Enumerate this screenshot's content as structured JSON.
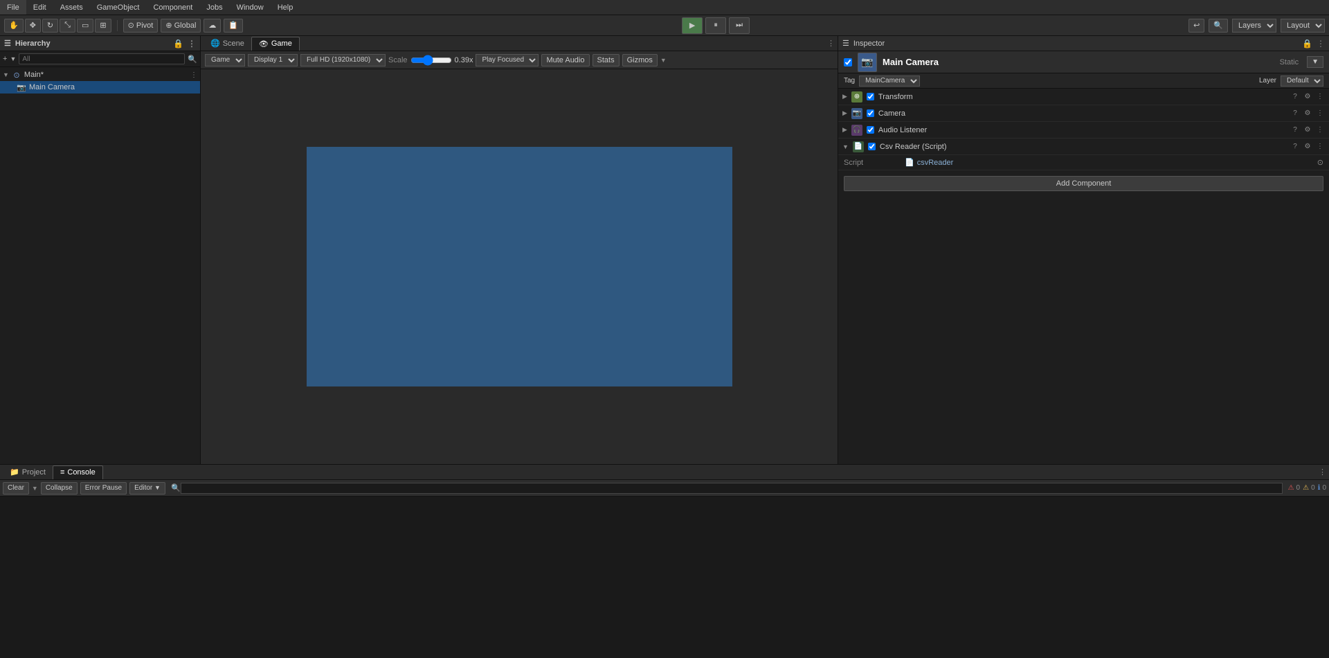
{
  "menubar": {
    "items": [
      "File",
      "Edit",
      "Assets",
      "GameObject",
      "Component",
      "Jobs",
      "Window",
      "Help"
    ]
  },
  "toolbar": {
    "layers_label": "Layers",
    "layout_label": "Layout"
  },
  "hierarchy": {
    "panel_title": "Hierarchy",
    "search_placeholder": "All",
    "items": [
      {
        "label": "Main*",
        "type": "scene",
        "indent": 0
      },
      {
        "label": "Main Camera",
        "type": "camera",
        "indent": 1
      }
    ]
  },
  "game_view": {
    "tabs": [
      {
        "label": "Scene",
        "active": false
      },
      {
        "label": "Game",
        "active": true
      }
    ],
    "toolbar": {
      "display": "Game",
      "display1": "Display 1",
      "resolution": "Full HD (1920x1080)",
      "scale_label": "Scale",
      "scale_value": "0.39x",
      "play_focused": "Play Focused",
      "mute_audio": "Mute Audio",
      "stats": "Stats",
      "gizmos": "Gizmos"
    },
    "canvas_color": "#2f5880"
  },
  "inspector": {
    "panel_title": "Inspector",
    "object_name": "Main Camera",
    "static_label": "Static",
    "tag_label": "Tag",
    "tag_value": "MainCamera",
    "layer_label": "Layer",
    "layer_value": "Default",
    "components": [
      {
        "name": "Transform",
        "type": "transform",
        "enabled": true
      },
      {
        "name": "Camera",
        "type": "camera",
        "enabled": true
      },
      {
        "name": "Audio Listener",
        "type": "audio",
        "enabled": true
      },
      {
        "name": "Csv Reader (Script)",
        "type": "script",
        "enabled": true
      }
    ],
    "script_label": "Script",
    "script_value": "csvReader",
    "add_component_label": "Add Component"
  },
  "bottom": {
    "tabs": [
      {
        "label": "Project",
        "active": false
      },
      {
        "label": "Console",
        "active": true
      }
    ],
    "console": {
      "clear_label": "Clear",
      "collapse_label": "Collapse",
      "error_pause_label": "Error Pause",
      "editor_label": "Editor",
      "search_placeholder": "",
      "error_count": "0",
      "warning_count": "0",
      "info_count": "0"
    }
  },
  "icons": {
    "play": "▶",
    "pause": "⏸",
    "step": "⏭",
    "chevron_right": "▶",
    "chevron_down": "▼",
    "menu_dots": "⋮",
    "lock": "🔒",
    "search": "🔍",
    "folder": "📁",
    "console": "≡",
    "scene_eye": "👁",
    "camera_icon": "📷",
    "audio_icon": "🎧",
    "script_icon": "📄",
    "question": "?",
    "settings": "⚙",
    "overflow": "⋮"
  }
}
